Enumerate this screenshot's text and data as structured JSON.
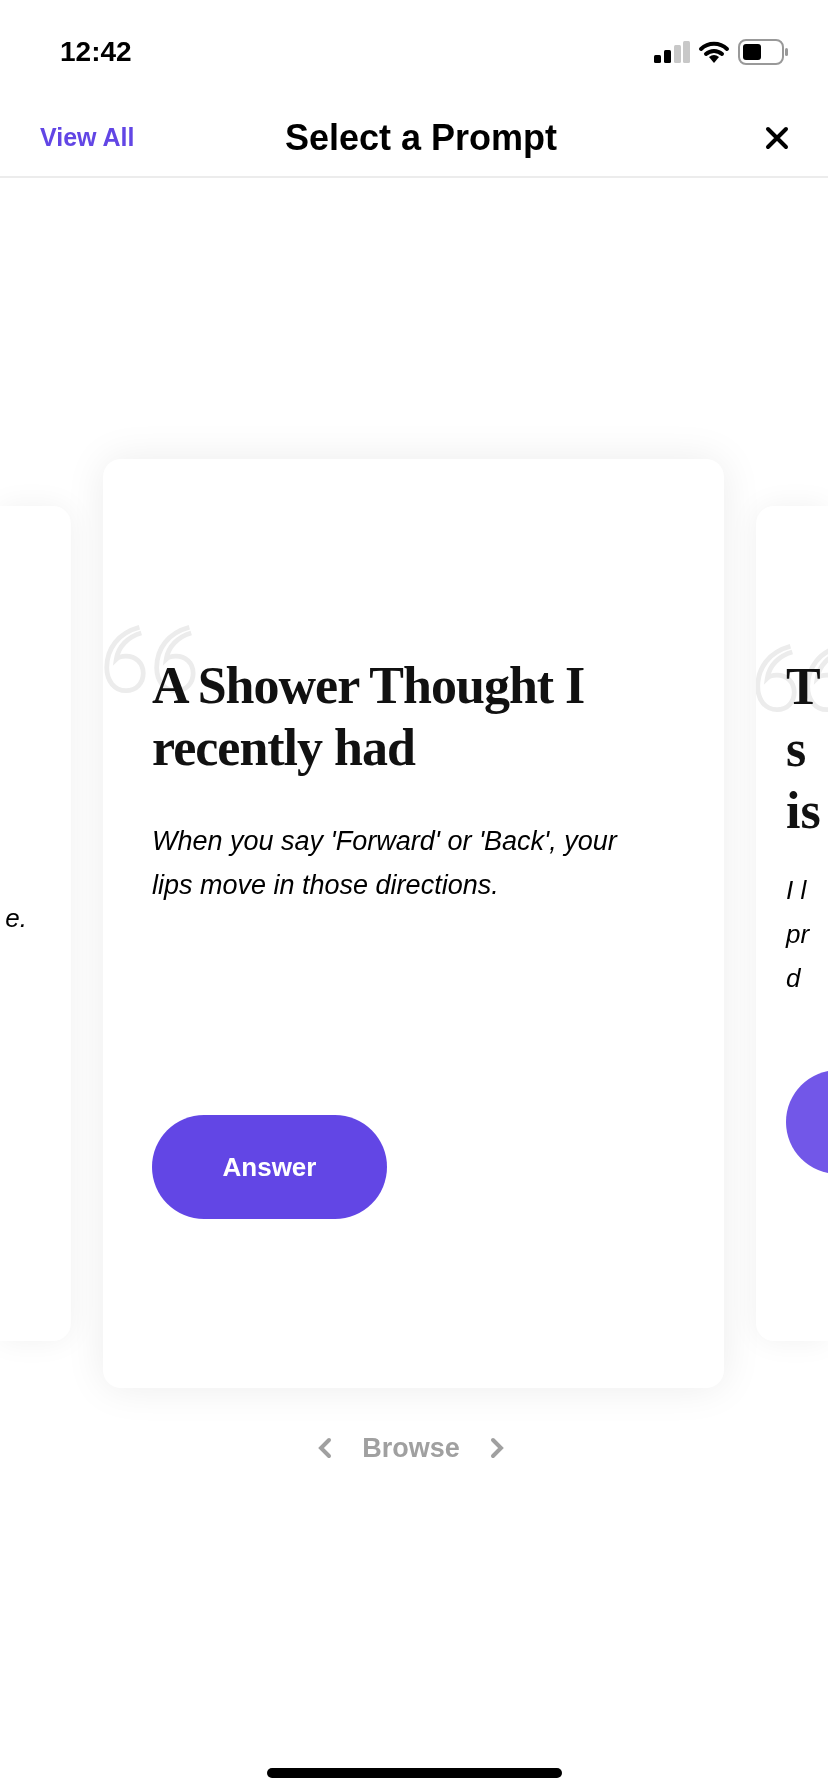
{
  "status_bar": {
    "time": "12:42"
  },
  "header": {
    "view_all": "View All",
    "title": "Select a Prompt"
  },
  "previous_card": {
    "body_lines": [
      "e."
    ]
  },
  "current_card": {
    "title": "A Shower Thought I recently had",
    "body": "When you say 'Forward' or 'Back', your lips move in those directions.",
    "button": "Answer"
  },
  "next_card": {
    "title_lines": [
      "T",
      "s",
      "is"
    ],
    "body_lines": [
      "I l",
      "pr",
      "d"
    ]
  },
  "browse": {
    "label": "Browse"
  }
}
